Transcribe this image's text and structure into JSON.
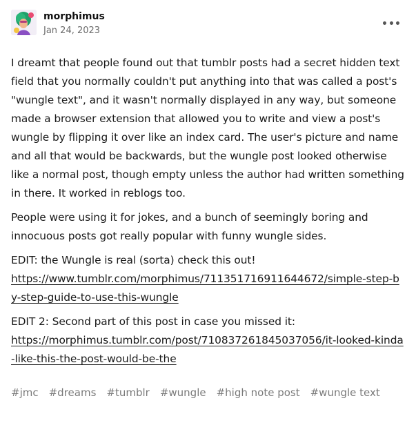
{
  "post": {
    "author": "morphimus",
    "date": "Jan 24, 2023",
    "paragraphs": [
      "I dreamt that people found out that tumblr posts had a secret hidden text field that you normally couldn't put anything into that was called a post's \"wungle text\", and it wasn't normally displayed in any way, but someone made a browser extension that allowed you to write and view a post's wungle by flipping it over like an index card. The user's picture and name and all that would be backwards, but the wungle post looked otherwise like a normal post, though empty unless the author had written something in there. It worked in reblogs too.",
      "People were using it for jokes, and a bunch of seemingly boring and innocuous posts got really popular with funny wungle sides."
    ],
    "edit1_text": "EDIT: the Wungle is real (sorta) check this out!",
    "edit1_link": "https://www.tumblr.com/morphimus/711351716911644672/simple-step-by-step-guide-to-use-this-wungle",
    "edit2_text": "EDIT 2: Second part of this post in case you missed it:",
    "edit2_link": "https://morphimus.tumblr.com/post/710837261845037056/it-looked-kinda-like-this-the-post-would-be-the",
    "tags": [
      "#jmc",
      "#dreams",
      "#tumblr",
      "#wungle",
      "#high note post",
      "#wungle text"
    ]
  },
  "icons": {
    "avatar": "avatar-character",
    "more": "more-options-icon"
  },
  "colors": {
    "text": "#1a1a1a",
    "meta": "#6b6b6b",
    "tag": "#7a7a7a"
  }
}
